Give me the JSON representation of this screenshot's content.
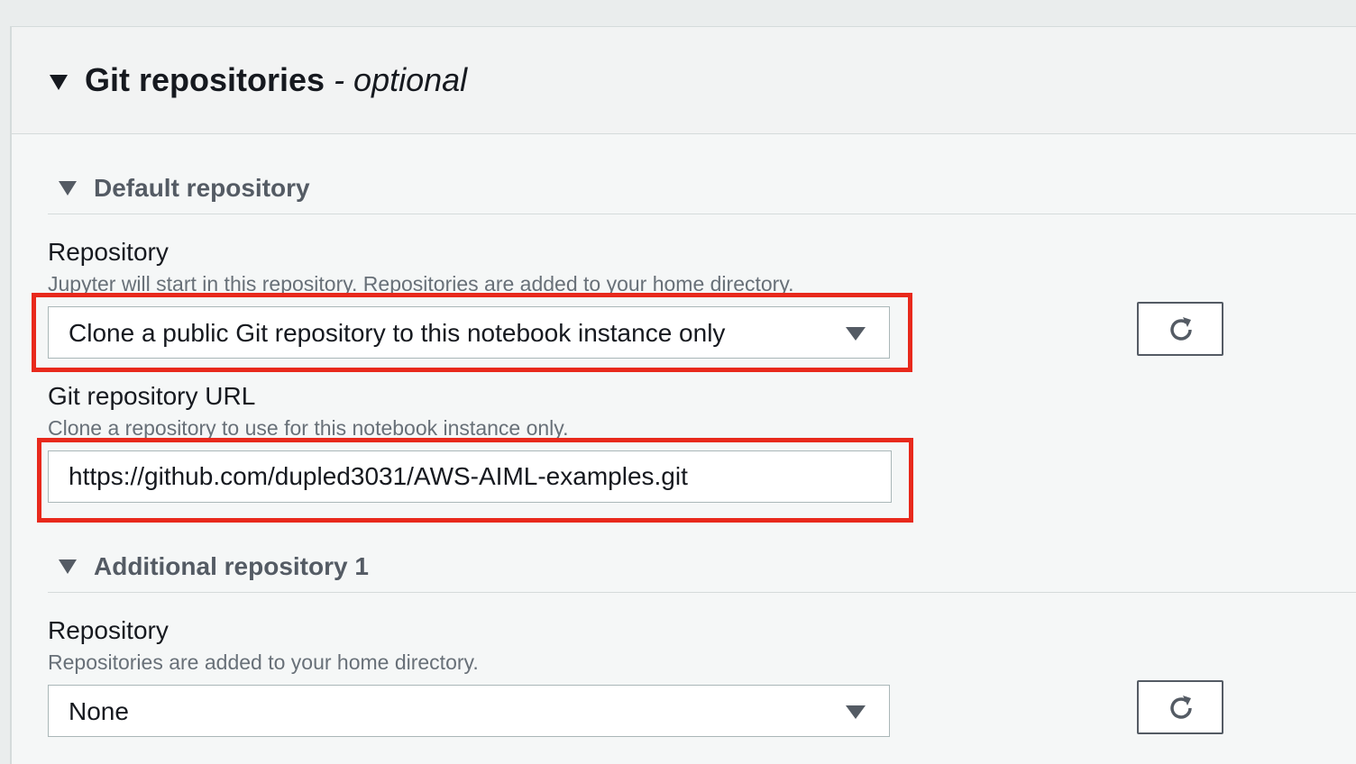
{
  "panel": {
    "title": "Git repositories",
    "optional_label": " - optional"
  },
  "default_repo": {
    "section_title": "Default repository",
    "repository_label": "Repository",
    "repository_description": "Jupyter will start in this repository. Repositories are added to your home directory.",
    "repository_selected": "Clone a public Git repository to this notebook instance only",
    "url_label": "Git repository URL",
    "url_description": "Clone a repository to use for this notebook instance only.",
    "url_value": "https://github.com/dupled3031/AWS-AIML-examples.git"
  },
  "additional_repo_1": {
    "section_title": "Additional repository 1",
    "repository_label": "Repository",
    "repository_description": "Repositories are added to your home directory.",
    "repository_selected": "None"
  },
  "icons": {
    "collapse": "caret-down-icon",
    "dropdown": "chevron-down-icon",
    "refresh": "refresh-icon"
  },
  "colors": {
    "highlight": "#e8291c",
    "text_primary": "#16191f",
    "text_secondary": "#687078",
    "border": "#aab7b8"
  }
}
